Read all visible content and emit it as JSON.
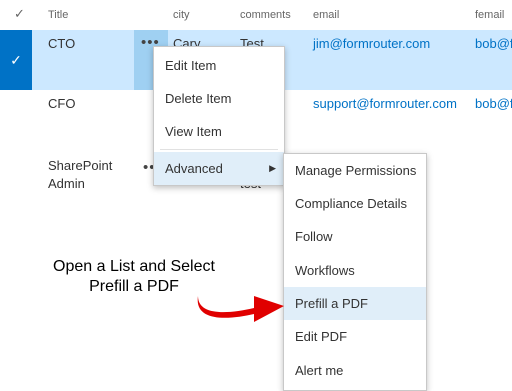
{
  "header": {
    "check_symbol": "✓",
    "columns": [
      "Title",
      "city",
      "comments",
      "email",
      "femail"
    ]
  },
  "rows": [
    {
      "title": "CTO",
      "city": "Cary",
      "comments": "Test",
      "email": "jim@formrouter.com",
      "femail": "bob@f",
      "selected": true,
      "check": "✓",
      "ellipsis": "•••"
    },
    {
      "title": "CFO",
      "email": "support@formrouter.com",
      "femail": "bob@f",
      "ellipsis": ""
    },
    {
      "title_line1": "SharePoint",
      "title_line2": "Admin",
      "ellipsis": "••",
      "comments": "test"
    }
  ],
  "context_menu": {
    "items": [
      "Edit Item",
      "Delete Item",
      "View Item"
    ],
    "advanced_label": "Advanced",
    "advanced_arrow": "▶"
  },
  "submenu": {
    "items": [
      "Manage Permissions",
      "Compliance Details",
      "Follow",
      "Workflows",
      "Prefill a PDF",
      "Edit PDF",
      "Alert me"
    ],
    "highlighted": "Prefill a PDF"
  },
  "annotation": {
    "line1": "Open a List and Select",
    "line2": "Prefill a PDF",
    "arrow_color": "#e00000"
  }
}
